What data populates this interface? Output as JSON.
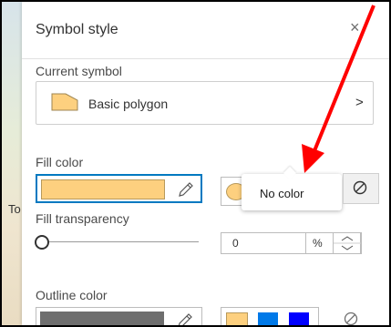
{
  "map": {
    "label_fragment": "To"
  },
  "panel": {
    "title": "Symbol style",
    "close_glyph": "×",
    "current_symbol": {
      "label": "Current symbol",
      "name": "Basic polygon",
      "arrow": ">"
    },
    "fill": {
      "label": "Fill color",
      "color": "#FDD07F",
      "edit_icon": "pencil-icon",
      "tooltip": "No color",
      "no_color_icon": "no-color-icon"
    },
    "transparency": {
      "label": "Fill transparency",
      "value": "0",
      "unit": "%",
      "level": 0
    },
    "outline": {
      "label": "Outline color",
      "color": "#6E6E6E",
      "preset_colors": [
        "#FDD07F",
        "#0079E8",
        "#0000FF"
      ]
    }
  },
  "colors": {
    "accent": "#0079C1",
    "annotation_arrow": "#FF0000"
  }
}
